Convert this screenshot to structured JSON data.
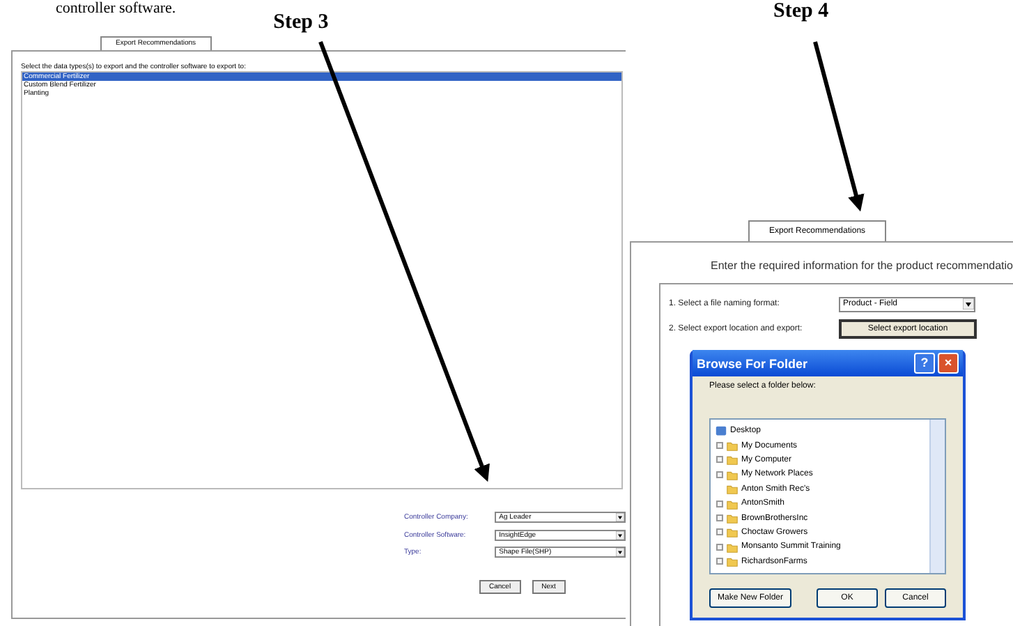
{
  "heading_fragment": "controller software.",
  "step3": {
    "caption": "Step 3",
    "tab": "Export Recommendations",
    "instruction": "Select the data types(s) to export and the controller software to export to:",
    "data_types": [
      {
        "label": "Commercial Fertilizer",
        "selected": true
      },
      {
        "label": "Custom Blend Fertilizer",
        "selected": false
      },
      {
        "label": "Planting",
        "selected": false
      }
    ],
    "fields": [
      {
        "label": "Controller Company:",
        "value": "Ag Leader"
      },
      {
        "label": "Controller Software:",
        "value": "InsightEdge"
      },
      {
        "label": "Type:",
        "value": "Shape File(SHP)"
      }
    ],
    "buttons": [
      "Cancel",
      "Next"
    ]
  },
  "step4": {
    "caption": "Step 4",
    "tab": "Export Recommendations",
    "heading": "Enter the required information for the product recommendatio",
    "row1_label": "1. Select a file naming format:",
    "row1_value": "Product - Field",
    "row2_label": "2. Select export location and export:",
    "row2_button": "Select export location",
    "dialog": {
      "title": "Browse For Folder",
      "help": "?",
      "close": "×",
      "prompt": "Please select a folder below:",
      "tree": [
        {
          "label": "Desktop",
          "expandable": false,
          "children": [
            {
              "label": "My Documents",
              "expandable": true
            },
            {
              "label": "My Computer",
              "expandable": true
            },
            {
              "label": "My Network Places",
              "expandable": true
            },
            {
              "label": "Anton Smith Rec's",
              "expandable": false
            },
            {
              "label": "AntonSmith",
              "expandable": true
            },
            {
              "label": "BrownBrothersInc",
              "expandable": true
            },
            {
              "label": "Choctaw Growers",
              "expandable": true
            },
            {
              "label": "Monsanto Summit Training",
              "expandable": true
            },
            {
              "label": "RichardsonFarms",
              "expandable": true
            }
          ]
        }
      ],
      "buttons": [
        "Make New Folder",
        "OK",
        "Cancel"
      ]
    }
  }
}
